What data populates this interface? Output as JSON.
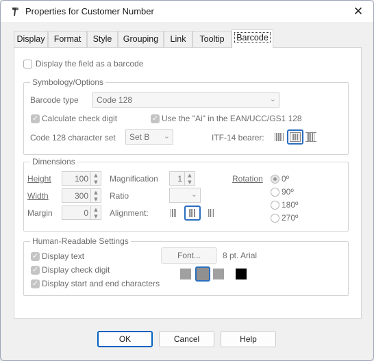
{
  "window": {
    "title": "Properties for Customer Number",
    "close_label": "✕"
  },
  "tabs": [
    {
      "label": "Display"
    },
    {
      "label": "Format"
    },
    {
      "label": "Style"
    },
    {
      "label": "Grouping"
    },
    {
      "label": "Link"
    },
    {
      "label": "Tooltip"
    },
    {
      "label": "Barcode",
      "active": true
    }
  ],
  "display_barcode": {
    "label": "Display the field as a barcode",
    "checked": false
  },
  "symbology": {
    "title": "Symbology/Options",
    "barcode_type_label": "Barcode type",
    "barcode_type_value": "Code 128",
    "calc_check_digit": {
      "label": "Calculate check digit",
      "checked": true
    },
    "use_ai": {
      "label": "Use the \"Ai\" in the EAN/UCC/GS1 128",
      "checked": true
    },
    "charset_label": "Code 128 character set",
    "charset_value": "Set B",
    "itf_label": "ITF-14 bearer:"
  },
  "dimensions": {
    "title": "Dimensions",
    "height_label": "Height",
    "height_value": "100",
    "width_label": "Width",
    "width_value": "300",
    "margin_label": "Margin",
    "margin_value": "0",
    "magnification_label": "Magnification",
    "magnification_value": "1",
    "ratio_label": "Ratio",
    "alignment_label": "Alignment:",
    "rotation_label": "Rotation",
    "rotation_options": [
      "0º",
      "90º",
      "180º",
      "270º"
    ],
    "rotation_selected": "0º"
  },
  "human_readable": {
    "title": "Human-Readable Settings",
    "display_text": {
      "label": "Display text",
      "checked": true
    },
    "display_check": {
      "label": "Display check digit",
      "checked": true
    },
    "display_start_end": {
      "label": "Display start and end characters",
      "checked": true
    },
    "font_button": "Font...",
    "font_desc": "8 pt. Arial",
    "swatch_colors": [
      "#a0a0a0",
      "#909090",
      "#a0a0a0",
      "#000000"
    ]
  },
  "buttons": {
    "ok": "OK",
    "cancel": "Cancel",
    "help": "Help"
  }
}
